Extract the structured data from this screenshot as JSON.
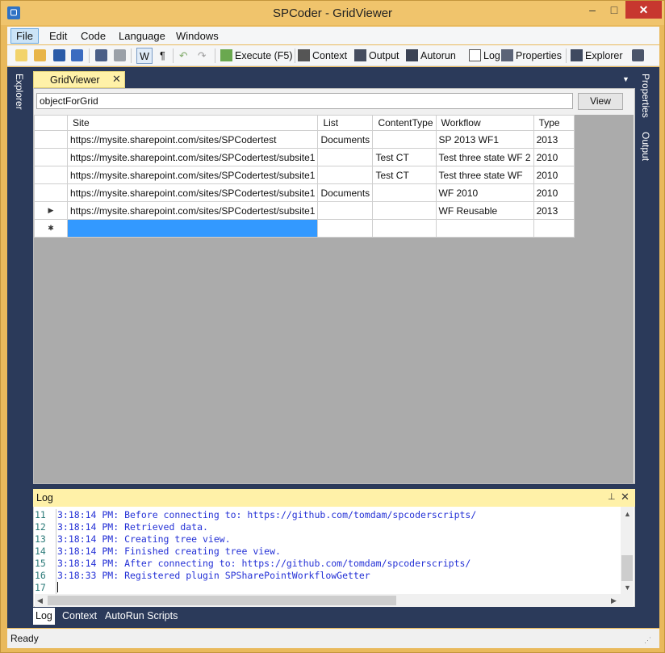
{
  "window": {
    "title": "SPCoder - GridViewer",
    "controls": {
      "minimize": "–",
      "maximize": "□",
      "close": "✕"
    }
  },
  "menu": {
    "items": [
      {
        "label": "File",
        "active": true
      },
      {
        "label": "Edit"
      },
      {
        "label": "Code"
      },
      {
        "label": "Language"
      },
      {
        "label": "Windows"
      }
    ]
  },
  "toolbar": {
    "word_wrap": "W",
    "pilcrow": "¶",
    "execute": "Execute (F5)",
    "context": "Context",
    "output": "Output",
    "autorun": "Autorun",
    "log": "Log",
    "properties": "Properties",
    "explorer": "Explorer"
  },
  "sidebar": {
    "left": "Explorer",
    "right_top": "Properties",
    "right_bottom": "Output"
  },
  "document": {
    "tab_label": "GridViewer",
    "tab_close": "✕",
    "tab_dropdown": "▼",
    "object_field": "objectForGrid",
    "view_button": "View"
  },
  "grid": {
    "columns": [
      "Site",
      "List",
      "ContentType",
      "Workflow",
      "Type"
    ],
    "rows": [
      {
        "marker": "",
        "cells": [
          "https://mysite.sharepoint.com/sites/SPCodertest",
          "Documents",
          "",
          "SP 2013 WF1",
          "2013"
        ]
      },
      {
        "marker": "",
        "cells": [
          "https://mysite.sharepoint.com/sites/SPCodertest/subsite1",
          "",
          "Test CT",
          "Test three state WF 2",
          "2010"
        ]
      },
      {
        "marker": "",
        "cells": [
          "https://mysite.sharepoint.com/sites/SPCodertest/subsite1",
          "",
          "Test CT",
          "Test three state WF",
          "2010"
        ]
      },
      {
        "marker": "",
        "cells": [
          "https://mysite.sharepoint.com/sites/SPCodertest/subsite1",
          "Documents",
          "",
          "WF 2010",
          "2010"
        ]
      },
      {
        "marker": "▶",
        "cells": [
          "https://mysite.sharepoint.com/sites/SPCodertest/subsite1",
          "",
          "",
          "WF Reusable",
          "2013"
        ]
      },
      {
        "marker": "✱",
        "cells": [
          "",
          "",
          "",
          "",
          ""
        ]
      }
    ]
  },
  "log": {
    "title": "Log",
    "pin": "📌",
    "close": "✕",
    "lines": [
      {
        "num": "11",
        "text": "3:18:14 PM: Before connecting to: https://github.com/tomdam/spcoderscripts/"
      },
      {
        "num": "12",
        "text": "3:18:14 PM: Retrieved data."
      },
      {
        "num": "13",
        "text": "3:18:14 PM: Creating tree view."
      },
      {
        "num": "14",
        "text": "3:18:14 PM: Finished creating tree view."
      },
      {
        "num": "15",
        "text": "3:18:14 PM: After connecting to: https://github.com/tomdam/spcoderscripts/"
      },
      {
        "num": "16",
        "text": "3:18:33 PM: Registered plugin SPSharePointWorkflowGetter"
      },
      {
        "num": "17",
        "text": ""
      }
    ]
  },
  "bottom_tabs": [
    {
      "label": "Log",
      "active": true
    },
    {
      "label": "Context"
    },
    {
      "label": "AutoRun Scripts"
    }
  ],
  "status": {
    "text": "Ready"
  },
  "colors": {
    "window_frame": "#e9b95c",
    "dock_background": "#2b3a5a",
    "tab_active": "#fff1a8",
    "selection": "#3399ff",
    "log_text": "#2431d6",
    "line_numbers": "#2b7a78"
  }
}
